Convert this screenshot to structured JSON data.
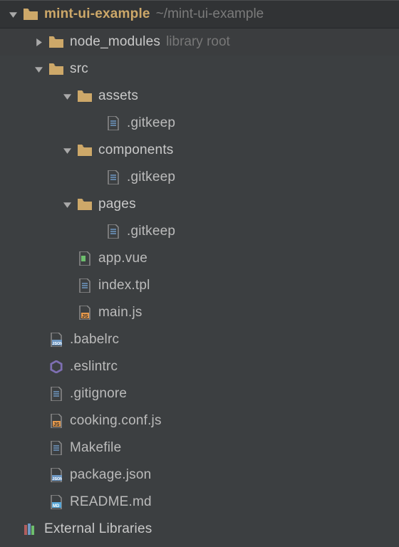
{
  "root": {
    "name": "mint-ui-example",
    "path": "~/mint-ui-example"
  },
  "nodes": {
    "node_modules": "node_modules",
    "library_hint": "library root",
    "src": "src",
    "assets": "assets",
    "components": "components",
    "pages": "pages",
    "gitkeep": ".gitkeep",
    "app_vue": "app.vue",
    "index_tpl": "index.tpl",
    "main_js": "main.js",
    "babelrc": ".babelrc",
    "eslintrc": ".eslintrc",
    "gitignore": ".gitignore",
    "cooking": "cooking.conf.js",
    "makefile": "Makefile",
    "package_json": "package.json",
    "readme": "README.md",
    "external_libs": "External Libraries"
  },
  "colors": {
    "folder_gold": "#CDA869",
    "file_grey": "#8C8C8C",
    "js_orange": "#E6994C",
    "json_blue": "#6E98C4",
    "md_badge": "#57A7D8",
    "purple": "#7E6FB3",
    "green": "#6DBE6D"
  }
}
